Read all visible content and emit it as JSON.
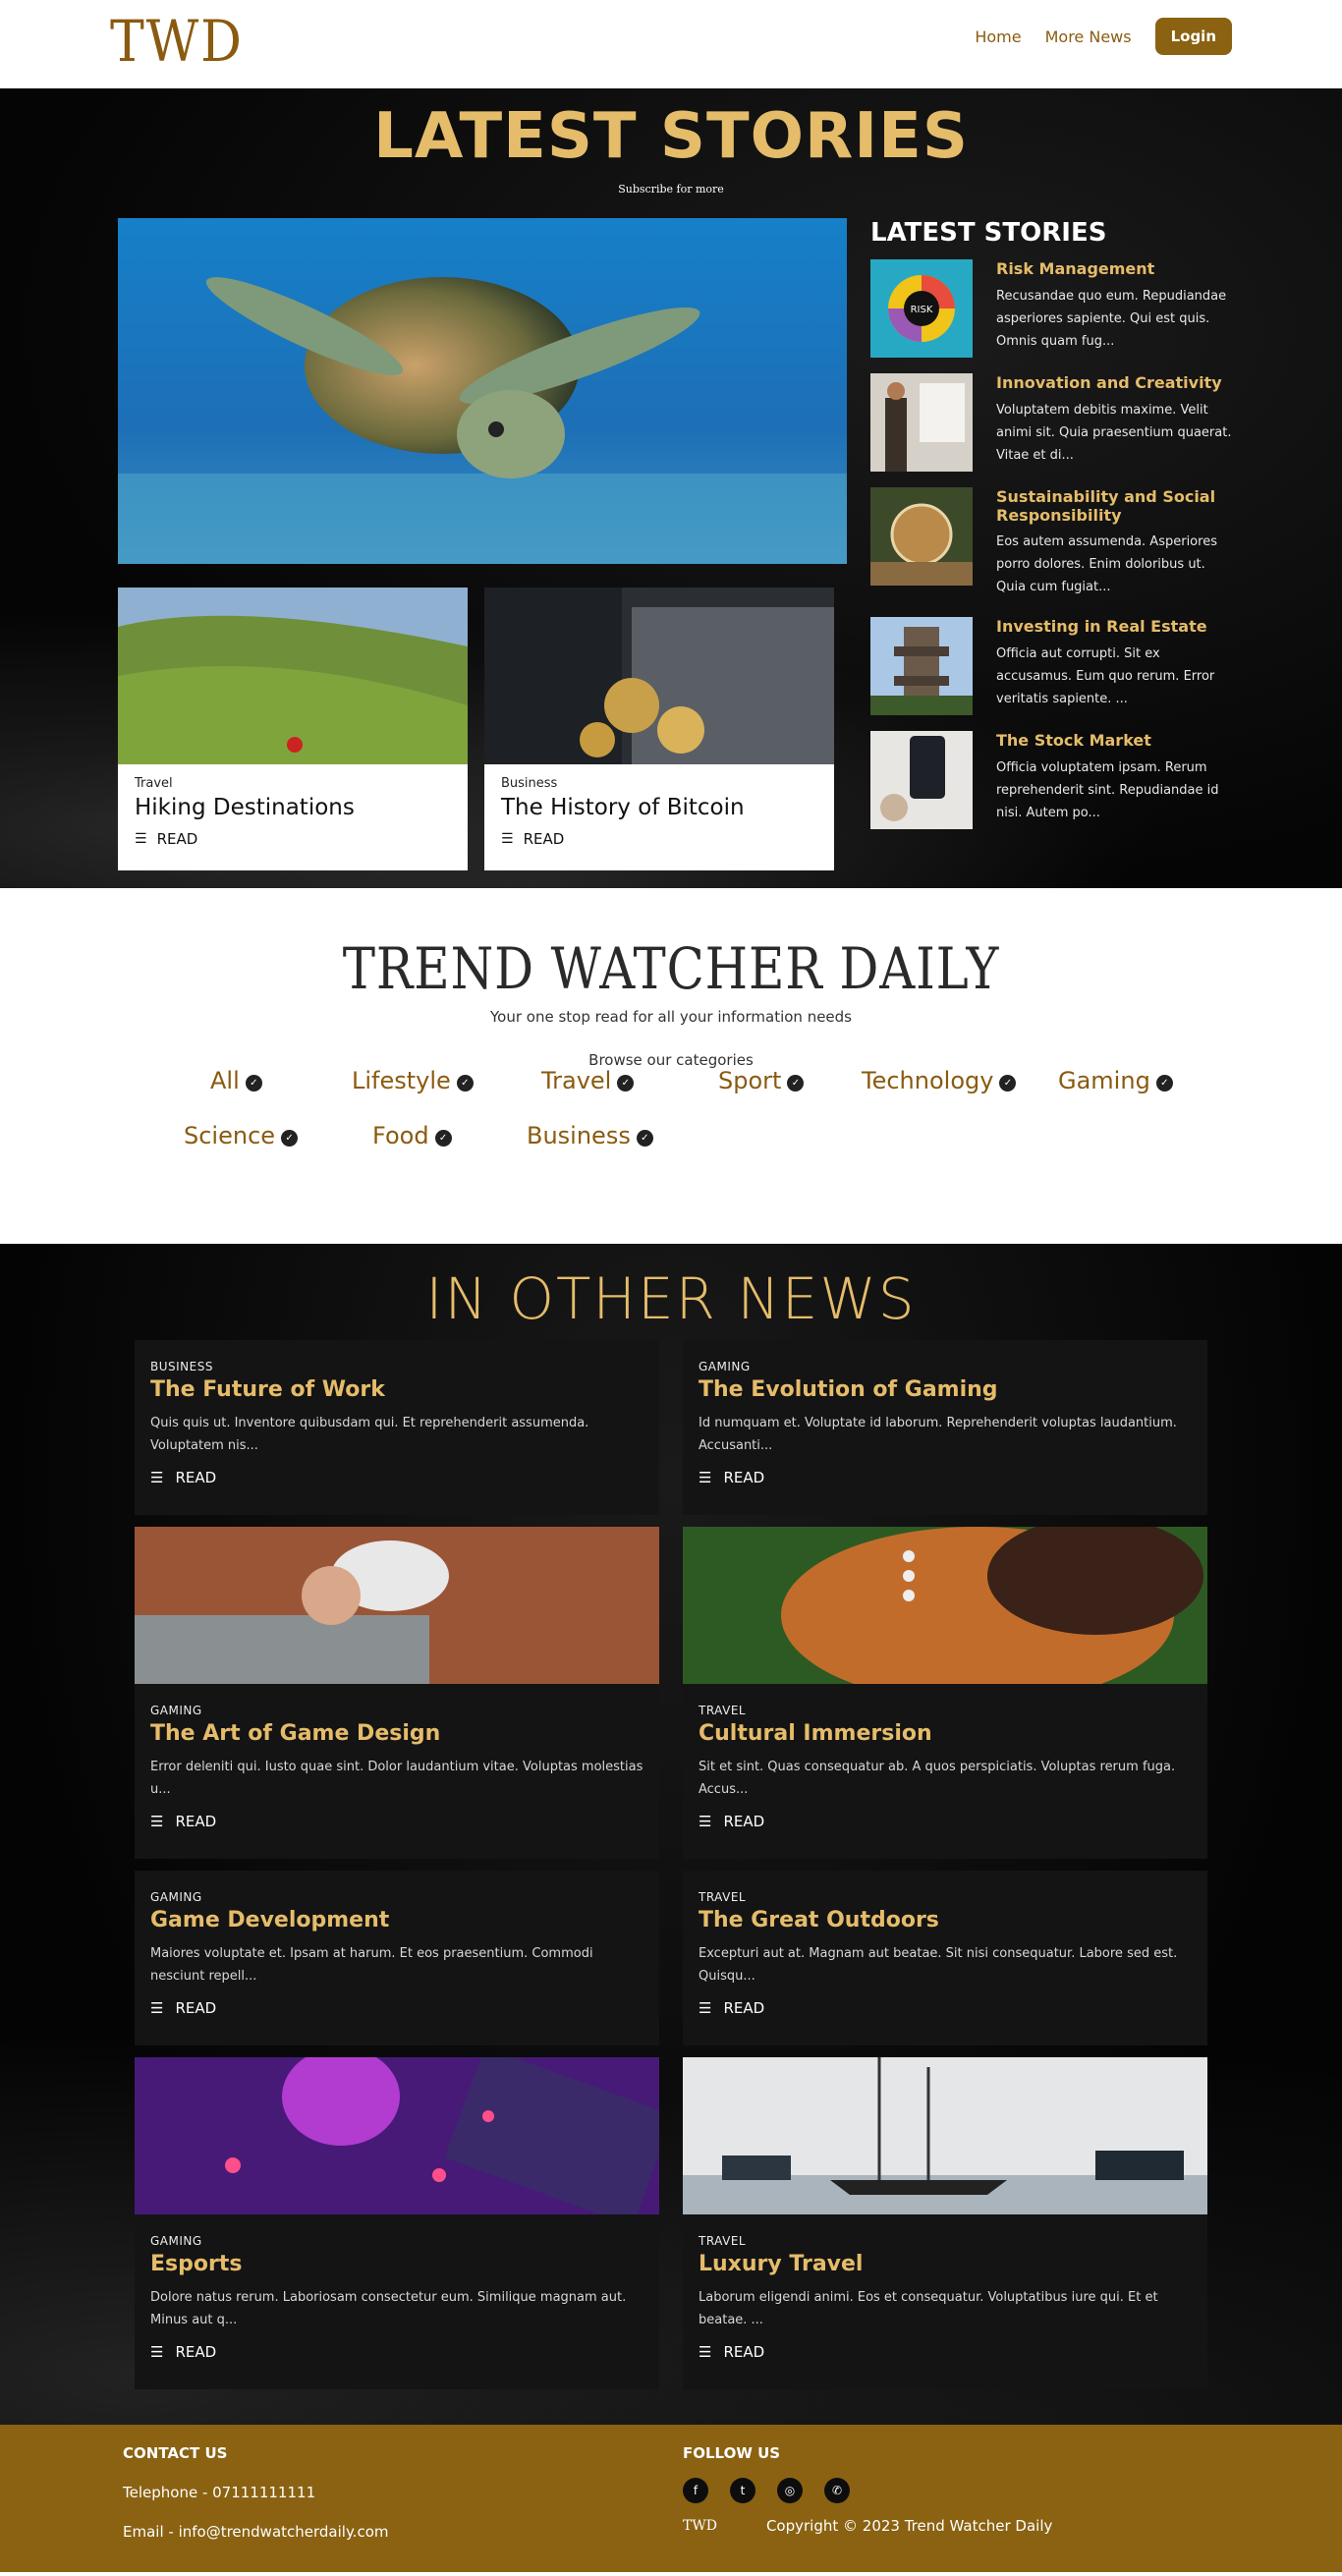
{
  "nav": {
    "logo": "TWD",
    "links": [
      "Home",
      "More News"
    ],
    "login": "Login"
  },
  "latest": {
    "title": "LATEST STORIES",
    "subtitle": "Subscribe for more",
    "cards": [
      {
        "category": "Travel",
        "title": "Hiking Destinations",
        "read": "READ"
      },
      {
        "category": "Business",
        "title": "The History of Bitcoin",
        "read": "READ"
      }
    ],
    "sidebar_title": "LATEST STORIES",
    "sidebar": [
      {
        "title": "Risk Management",
        "text": "Recusandae quo eum. Repudiandae asperiores sapiente. Qui est quis. Omnis quam fug..."
      },
      {
        "title": "Innovation and Creativity",
        "text": "Voluptatem debitis maxime. Velit animi sit. Quia praesentium quaerat. Vitae et di..."
      },
      {
        "title": "Sustainability and Social Responsibility",
        "text": "Eos autem assumenda. Asperiores porro dolores. Enim doloribus ut. Quia cum fugiat..."
      },
      {
        "title": "Investing in Real Estate",
        "text": "Officia aut corrupti. Sit ex accusamus. Eum quo rerum. Error veritatis sapiente. ..."
      },
      {
        "title": "The Stock Market",
        "text": "Officia voluptatem ipsam. Rerum reprehenderit sint. Repudiandae id nisi. Autem po..."
      }
    ],
    "risk_label": "RISK"
  },
  "twd": {
    "title": "TREND WATCHER DAILY",
    "tagline": "Your one stop read for all your information needs",
    "browse": "Browse our categories",
    "categories": [
      "All",
      "Lifestyle",
      "Travel",
      "Sport",
      "Technology",
      "Gaming",
      "Science",
      "Food",
      "Business"
    ]
  },
  "other": {
    "title": "IN OTHER NEWS",
    "read": "READ",
    "articles": [
      {
        "category": "BUSINESS",
        "title": "The Future of Work",
        "text": "Quis quis ut. Inventore quibusdam qui. Et reprehenderit assumenda. Voluptatem nis..."
      },
      {
        "category": "GAMING",
        "title": "The Evolution of Gaming",
        "text": "Id numquam et. Voluptate id laborum. Reprehenderit voluptas laudantium. Accusanti..."
      },
      {
        "category": "GAMING",
        "title": "The Art of Game Design",
        "text": "Error deleniti qui. Iusto quae sint. Dolor laudantium vitae. Voluptas molestias u..."
      },
      {
        "category": "TRAVEL",
        "title": "Cultural Immersion",
        "text": "Sit et sint. Quas consequatur ab. A quos perspiciatis. Voluptas rerum fuga. Accus..."
      },
      {
        "category": "GAMING",
        "title": "Game Development",
        "text": "Maiores voluptate et. Ipsam at harum. Et eos praesentium. Commodi nesciunt repell..."
      },
      {
        "category": "TRAVEL",
        "title": "The Great Outdoors",
        "text": "Excepturi aut at. Magnam aut beatae. Sit nisi consequatur. Labore sed est. Quisqu..."
      },
      {
        "category": "GAMING",
        "title": "Esports",
        "text": "Dolore natus rerum. Laboriosam consectetur eum. Similique magnam aut. Minus aut q..."
      },
      {
        "category": "TRAVEL",
        "title": "Luxury Travel",
        "text": "Laborum eligendi animi. Eos et consequatur. Voluptatibus iure qui. Et et beatae. ..."
      }
    ]
  },
  "footer": {
    "contact_head": "CONTACT US",
    "telephone": "Telephone - 07111111111",
    "email": "Email - info@trendwatcherdaily.com",
    "follow_head": "FOLLOW US",
    "logo": "TWD",
    "copyright": "Copyright © 2023 Trend Watcher Daily",
    "socials": [
      "facebook-icon",
      "twitter-icon",
      "instagram-icon",
      "whatsapp-icon"
    ]
  },
  "colors": {
    "accent": "#e5bc6a",
    "brand": "#8a6212",
    "dark": "#050505"
  }
}
